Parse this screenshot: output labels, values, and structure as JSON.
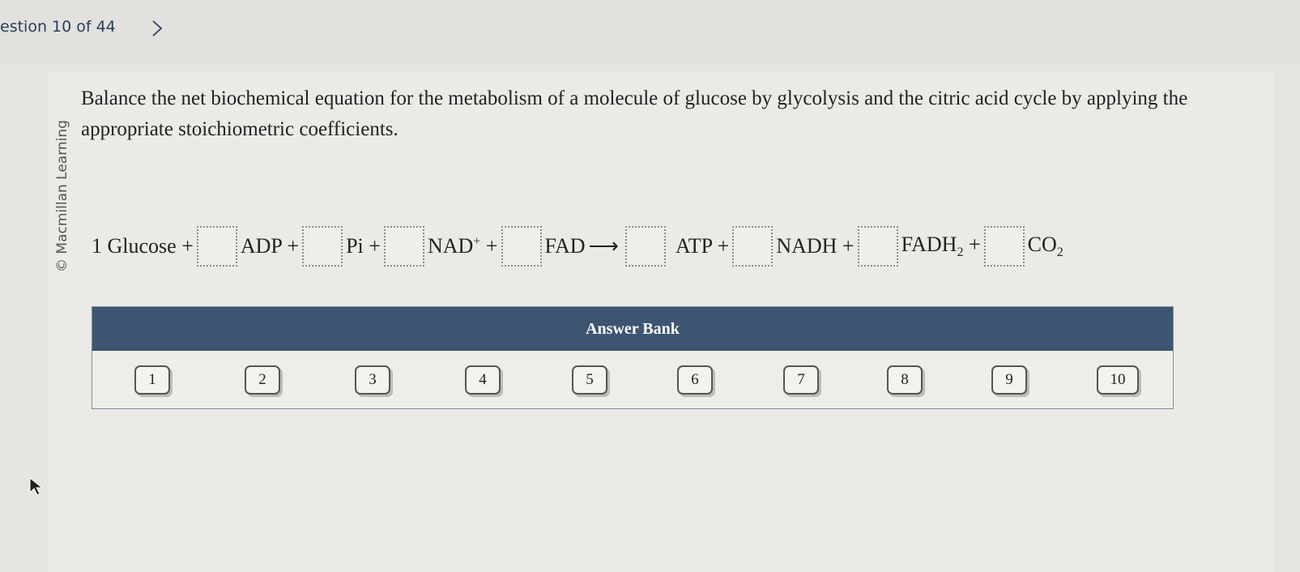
{
  "nav": {
    "question_label": "estion 10 of 44"
  },
  "credit": "© Macmillan Learning",
  "prompt": "Balance the net biochemical equation for the metabolism of a molecule of glucose by glycolysis and the citric acid cycle by applying the appropriate stoichiometric coefficients.",
  "equation": {
    "t_glucose": "1 Glucose +",
    "t_adp": "ADP +",
    "t_pi": "Pi +",
    "t_nad": "NAD",
    "t_nad_sup": "+",
    "t_plus1": " +",
    "t_fad": "FAD",
    "t_arrow": "⟶",
    "t_atp": "ATP +",
    "t_nadh": "NADH +",
    "t_fadh": "FADH",
    "t_fadh_sub": "2",
    "t_plus2": " +",
    "t_co": "CO",
    "t_co_sub": "2"
  },
  "answer_bank": {
    "title": "Answer Bank",
    "tiles": [
      "1",
      "2",
      "3",
      "4",
      "5",
      "6",
      "7",
      "8",
      "9",
      "10"
    ]
  },
  "colors": {
    "bank_header": "#3e5572",
    "nav_text": "#2a3e5c"
  }
}
